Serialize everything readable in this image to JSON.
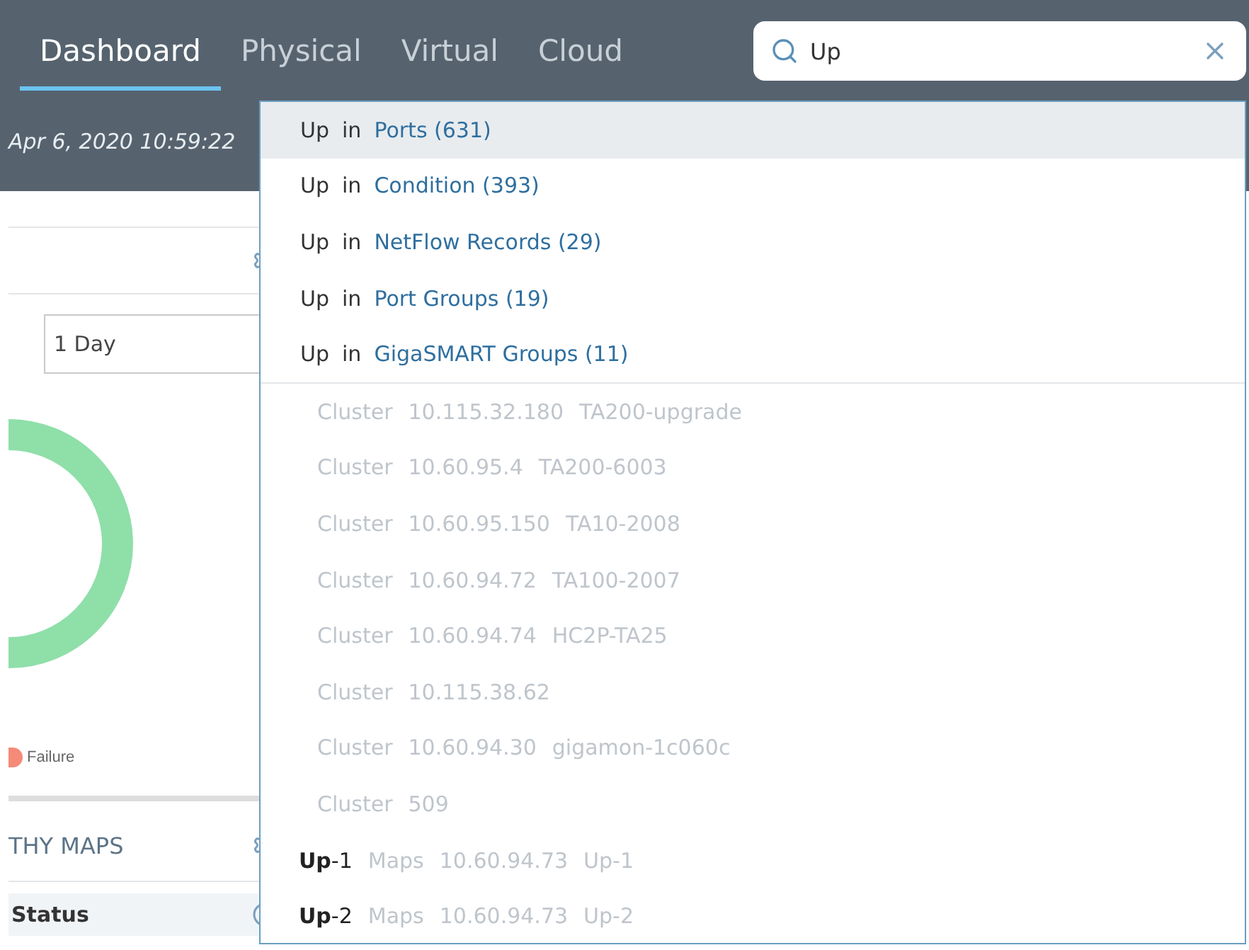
{
  "tabs": [
    {
      "label": "Dashboard",
      "selected": true
    },
    {
      "label": "Physical",
      "selected": false
    },
    {
      "label": "Virtual",
      "selected": false
    },
    {
      "label": "Cloud",
      "selected": false
    }
  ],
  "search": {
    "value": "Up"
  },
  "timestamp": "Apr 6, 2020 10:59:22",
  "panel": {
    "range_select": {
      "value": "1 Day"
    },
    "legend": [
      {
        "label": "Failure",
        "color": "#f58a78"
      }
    ],
    "maps_title": "THY MAPS",
    "table_header": "Status"
  },
  "suggestions": {
    "categories": [
      {
        "term": "Up",
        "connector": "in",
        "target": "Ports (631)",
        "selected": true
      },
      {
        "term": "Up",
        "connector": "in",
        "target": "Condition (393)",
        "selected": false
      },
      {
        "term": "Up",
        "connector": "in",
        "target": "NetFlow Records (29)",
        "selected": false
      },
      {
        "term": "Up",
        "connector": "in",
        "target": "Port Groups (19)",
        "selected": false
      },
      {
        "term": "Up",
        "connector": "in",
        "target": "GigaSMART Groups (11)",
        "selected": false
      }
    ],
    "clusters": [
      {
        "type": "Cluster",
        "address": "10.115.32.180",
        "name": "TA200-upgrade"
      },
      {
        "type": "Cluster",
        "address": "10.60.95.4",
        "name": "TA200-6003"
      },
      {
        "type": "Cluster",
        "address": "10.60.95.150",
        "name": "TA10-2008"
      },
      {
        "type": "Cluster",
        "address": "10.60.94.72",
        "name": "TA100-2007"
      },
      {
        "type": "Cluster",
        "address": "10.60.94.74",
        "name": "HC2P-TA25"
      },
      {
        "type": "Cluster",
        "address": "10.115.38.62"
      },
      {
        "type": "Cluster",
        "address": "10.60.94.30",
        "name": "gigamon-1c060c"
      },
      {
        "type": "Cluster",
        "address": "509"
      }
    ],
    "maps": [
      {
        "title": "**Up**-1",
        "type": "Maps",
        "address": "10.60.94.73",
        "name": "Up-1"
      },
      {
        "title": "**Up**-2",
        "type": "Maps",
        "address": "10.60.94.73",
        "name": "Up-2"
      }
    ]
  }
}
